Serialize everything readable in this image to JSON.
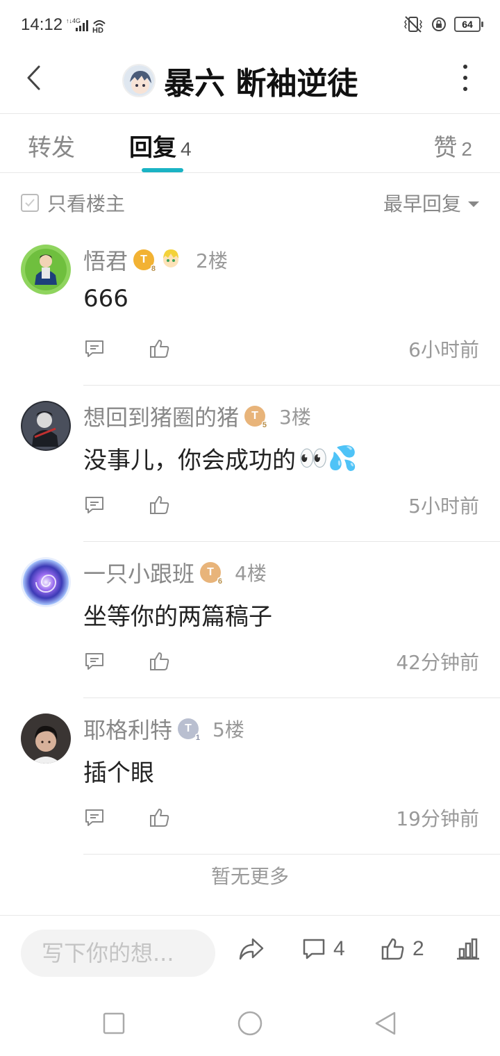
{
  "status": {
    "time": "14:12",
    "network": "4G",
    "hd": "HD",
    "battery": "64"
  },
  "header": {
    "title": "暴六 断袖逆徒"
  },
  "tabs": [
    {
      "label": "转发",
      "count": ""
    },
    {
      "label": "回复",
      "count": "4"
    },
    {
      "label": "赞",
      "count": "2"
    }
  ],
  "filter": {
    "only_op": "只看楼主",
    "sort": "最早回复"
  },
  "replies": [
    {
      "username": "悟君",
      "level": "T",
      "level_num": "8",
      "floor": "2楼",
      "content": "666",
      "emoji": "",
      "time": "6小时前",
      "badge_color": "#f2b233",
      "avatar_color": "#7ec850",
      "extra_badge": true
    },
    {
      "username": "想回到猪圈的猪",
      "level": "T",
      "level_num": "5",
      "floor": "3楼",
      "content": "没事儿，你会成功的",
      "emoji": "👀💦",
      "time": "5小时前",
      "badge_color": "#e8b47a",
      "avatar_color": "#3b3f48",
      "extra_badge": false
    },
    {
      "username": "一只小跟班",
      "level": "T",
      "level_num": "6",
      "floor": "4楼",
      "content": "坐等你的两篇稿子",
      "emoji": "",
      "time": "42分钟前",
      "badge_color": "#e8b47a",
      "avatar_color": "#5a4fc2",
      "extra_badge": false
    },
    {
      "username": "耶格利特",
      "level": "T",
      "level_num": "1",
      "floor": "5楼",
      "content": "插个眼",
      "emoji": "",
      "time": "19分钟前",
      "badge_color": "#b9bfd0",
      "avatar_color": "#2e2a28",
      "extra_badge": false
    }
  ],
  "no_more": "暂无更多",
  "bottom": {
    "placeholder": "写下你的想...",
    "comment_count": "4",
    "like_count": "2"
  }
}
